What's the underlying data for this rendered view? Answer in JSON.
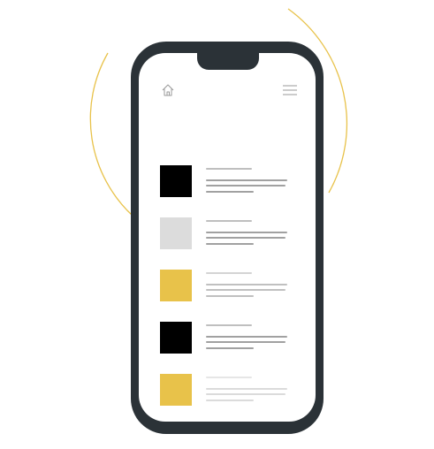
{
  "colors": {
    "background": "#ffffff",
    "phone_frame": "#2b3237",
    "screen": "#ffffff",
    "accent_arc": "#e8c24a",
    "icon_stroke": "#9a9a9a"
  },
  "header": {
    "home_icon": "home-icon",
    "menu_icon": "hamburger-menu-icon"
  },
  "list": {
    "items": [
      {
        "thumb_color": "#000000",
        "line_color": "#8a8a8a"
      },
      {
        "thumb_color": "#dcdcdc",
        "line_color": "#8a8a8a"
      },
      {
        "thumb_color": "#e8c24a",
        "line_color": "#b0b0b0"
      },
      {
        "thumb_color": "#000000",
        "line_color": "#8a8a8a"
      },
      {
        "thumb_color": "#e8c24a",
        "line_color": "#d2d2d2"
      }
    ]
  }
}
